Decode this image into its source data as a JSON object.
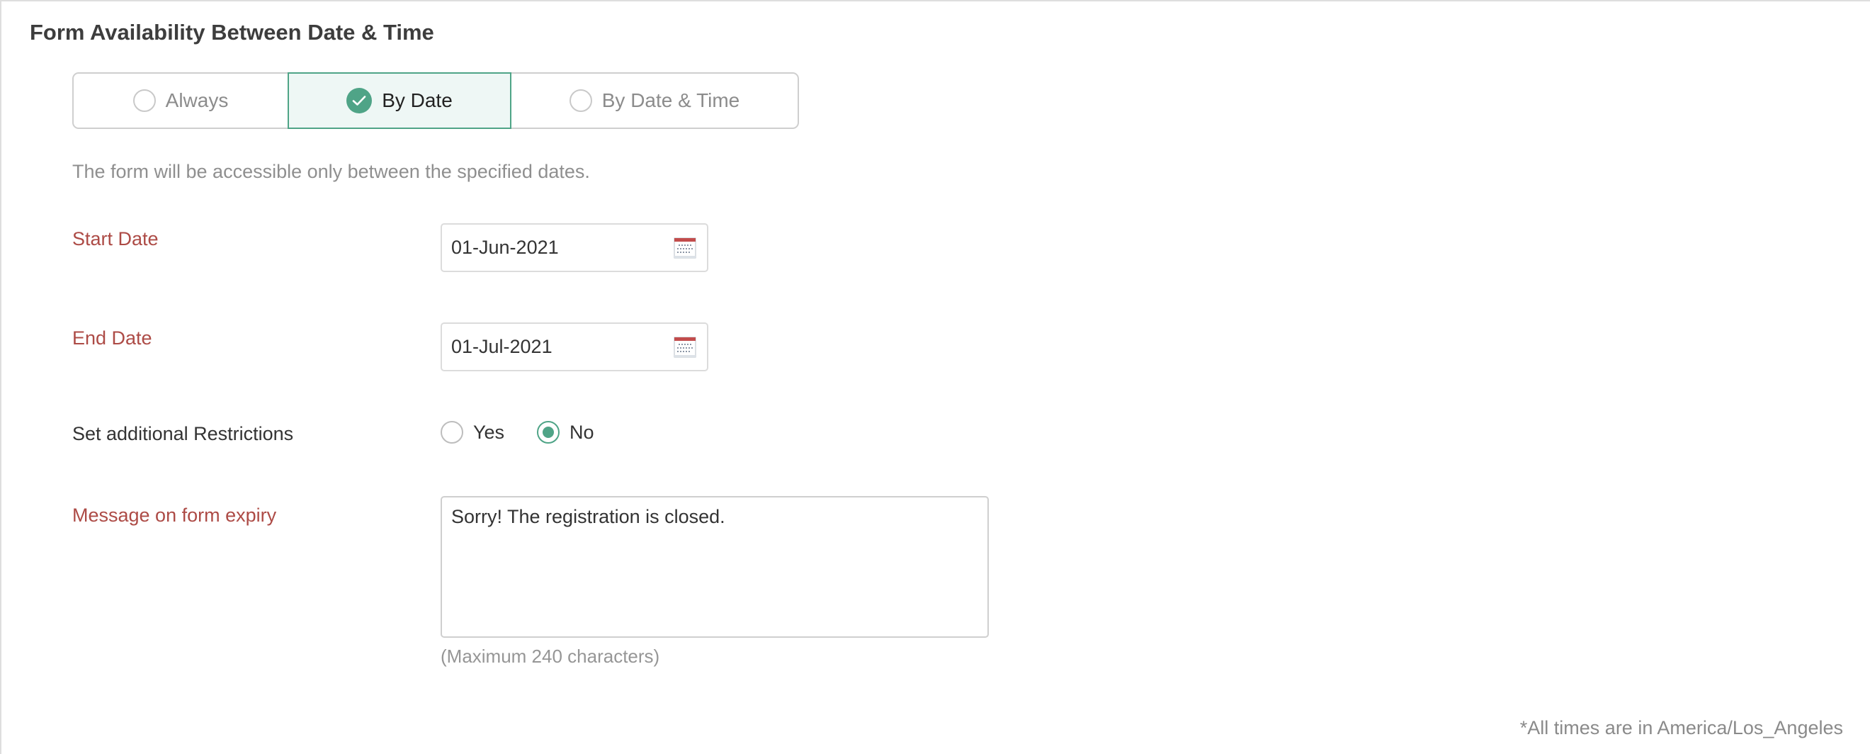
{
  "section": {
    "title": "Form Availability Between Date & Time"
  },
  "availability_mode": {
    "options": [
      {
        "label": "Always",
        "selected": false
      },
      {
        "label": "By Date",
        "selected": true
      },
      {
        "label": "By Date & Time",
        "selected": false
      }
    ],
    "description": "The form will be accessible only between the specified dates."
  },
  "fields": {
    "start_date": {
      "label": "Start Date",
      "value": "01-Jun-2021",
      "icon": "calendar-icon"
    },
    "end_date": {
      "label": "End Date",
      "value": "01-Jul-2021",
      "icon": "calendar-icon"
    },
    "additional_restrictions": {
      "label": "Set additional Restrictions",
      "options": [
        {
          "label": "Yes",
          "selected": false
        },
        {
          "label": "No",
          "selected": true
        }
      ]
    },
    "expiry_message": {
      "label": "Message on form expiry",
      "value": "Sorry! The registration is closed.",
      "hint": "(Maximum 240 characters)"
    }
  },
  "footer": {
    "timezone_note": "*All times are in America/Los_Angeles"
  },
  "colors": {
    "accent": "#4fa487",
    "accent_bg": "#eef7f5",
    "required_label": "#ad4b46",
    "muted_text": "#8f8f8f"
  }
}
